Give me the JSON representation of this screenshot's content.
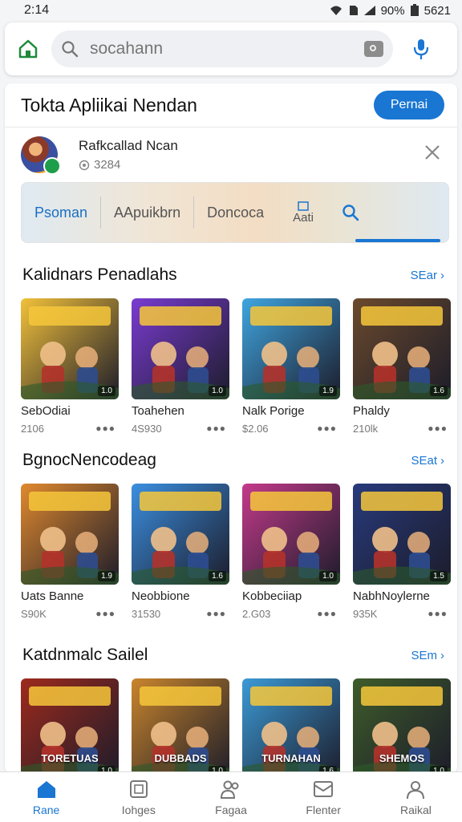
{
  "status_bar": {
    "time": "2:14",
    "battery": "90%",
    "clock_right": "5621"
  },
  "search": {
    "placeholder": "socahann"
  },
  "store": {
    "title": "Tokta Apliikai Nendan",
    "primary_button": "Pernai"
  },
  "account": {
    "name": "Rafkcallad Ncan",
    "sub": "3284"
  },
  "tabs": {
    "items": [
      "Psoman",
      "AApuikbrn",
      "Doncoca"
    ],
    "more_label": "Aati"
  },
  "sections": [
    {
      "title": "Kalidnars Penadlahs",
      "see_label": "SEar",
      "apps": [
        {
          "name": "SebOdiai",
          "meta": "2106",
          "rating": "1.0",
          "theme": "#f2c13a"
        },
        {
          "name": "Toahehen",
          "meta": "4S930",
          "rating": "1.0",
          "theme": "#7a3bd1"
        },
        {
          "name": "Nalk Porige",
          "meta": "$2.06",
          "rating": "1.9",
          "theme": "#3fa5e0"
        },
        {
          "name": "Phaldy",
          "meta": "210lk",
          "rating": "1.6",
          "theme": "#6b4a2c"
        }
      ]
    },
    {
      "title": "BgnocNencodeag",
      "see_label": "SEat",
      "apps": [
        {
          "name": "Uats Banne",
          "meta": "S90K",
          "rating": "1.9",
          "theme": "#e0892e"
        },
        {
          "name": "Neobbione",
          "meta": "31530",
          "rating": "1.6",
          "theme": "#3b8fe0"
        },
        {
          "name": "Kobbeciiap",
          "meta": "2.G03",
          "rating": "1.0",
          "theme": "#c43a8b"
        },
        {
          "name": "NabhNoylerne",
          "meta": "935K",
          "rating": "1.5",
          "theme": "#283a7c"
        }
      ]
    },
    {
      "title": "Katdnmalc Sailel",
      "see_label": "SEm",
      "apps": [
        {
          "rating": "1.0",
          "theme": "#9e2a1d",
          "label": "TORETUAS"
        },
        {
          "rating": "1.0",
          "theme": "#c9852c",
          "label": "DUBBADS"
        },
        {
          "rating": "1.6",
          "theme": "#3b9ad6",
          "label": "TURNAHAN"
        },
        {
          "rating": "1.0",
          "theme": "#3e5c2a",
          "label": "SHEMOS"
        }
      ]
    }
  ],
  "bottom_nav": [
    {
      "label": "Rane",
      "icon": "home-icon"
    },
    {
      "label": "Iohges",
      "icon": "apps-icon"
    },
    {
      "label": "Fagaa",
      "icon": "people-icon"
    },
    {
      "label": "Flenter",
      "icon": "inbox-icon"
    },
    {
      "label": "Raikal",
      "icon": "account-icon"
    }
  ],
  "colors": {
    "accent": "#1976d2",
    "home_icon": "#1e8a3a"
  }
}
